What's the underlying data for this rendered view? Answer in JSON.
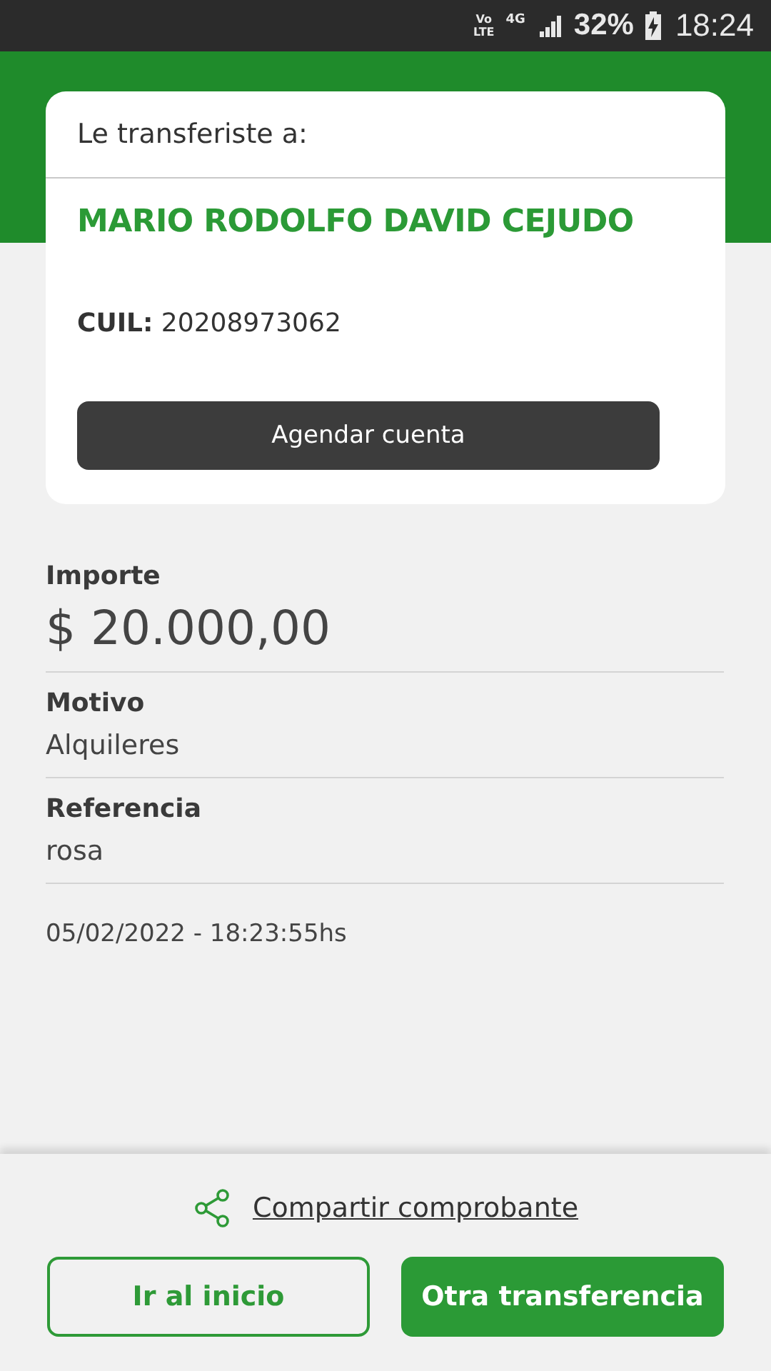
{
  "status_bar": {
    "volte": "Vo\nLTE",
    "network": "4G",
    "battery": "32%",
    "time": "18:24"
  },
  "recipient_card": {
    "title": "Le transferiste a:",
    "name": "MARIO RODOLFO DAVID CEJUDO",
    "cuil_label": "CUIL:",
    "cuil": "20208973062",
    "button": "Agendar cuenta"
  },
  "details": [
    {
      "kind": "amount",
      "label": "Importe",
      "value": "$ 20.000,00"
    },
    {
      "kind": "text",
      "label": "Motivo",
      "value": "Alquileres"
    },
    {
      "kind": "text",
      "label": "Referencia",
      "value": "rosa"
    }
  ],
  "timestamp": "05/02/2022 - 18:23:55hs",
  "share_link": "Compartir comprobante",
  "buttons": [
    {
      "kind": "outline",
      "label": "Ir al inicio"
    },
    {
      "kind": "filled",
      "label": "Otra transferencia"
    }
  ]
}
